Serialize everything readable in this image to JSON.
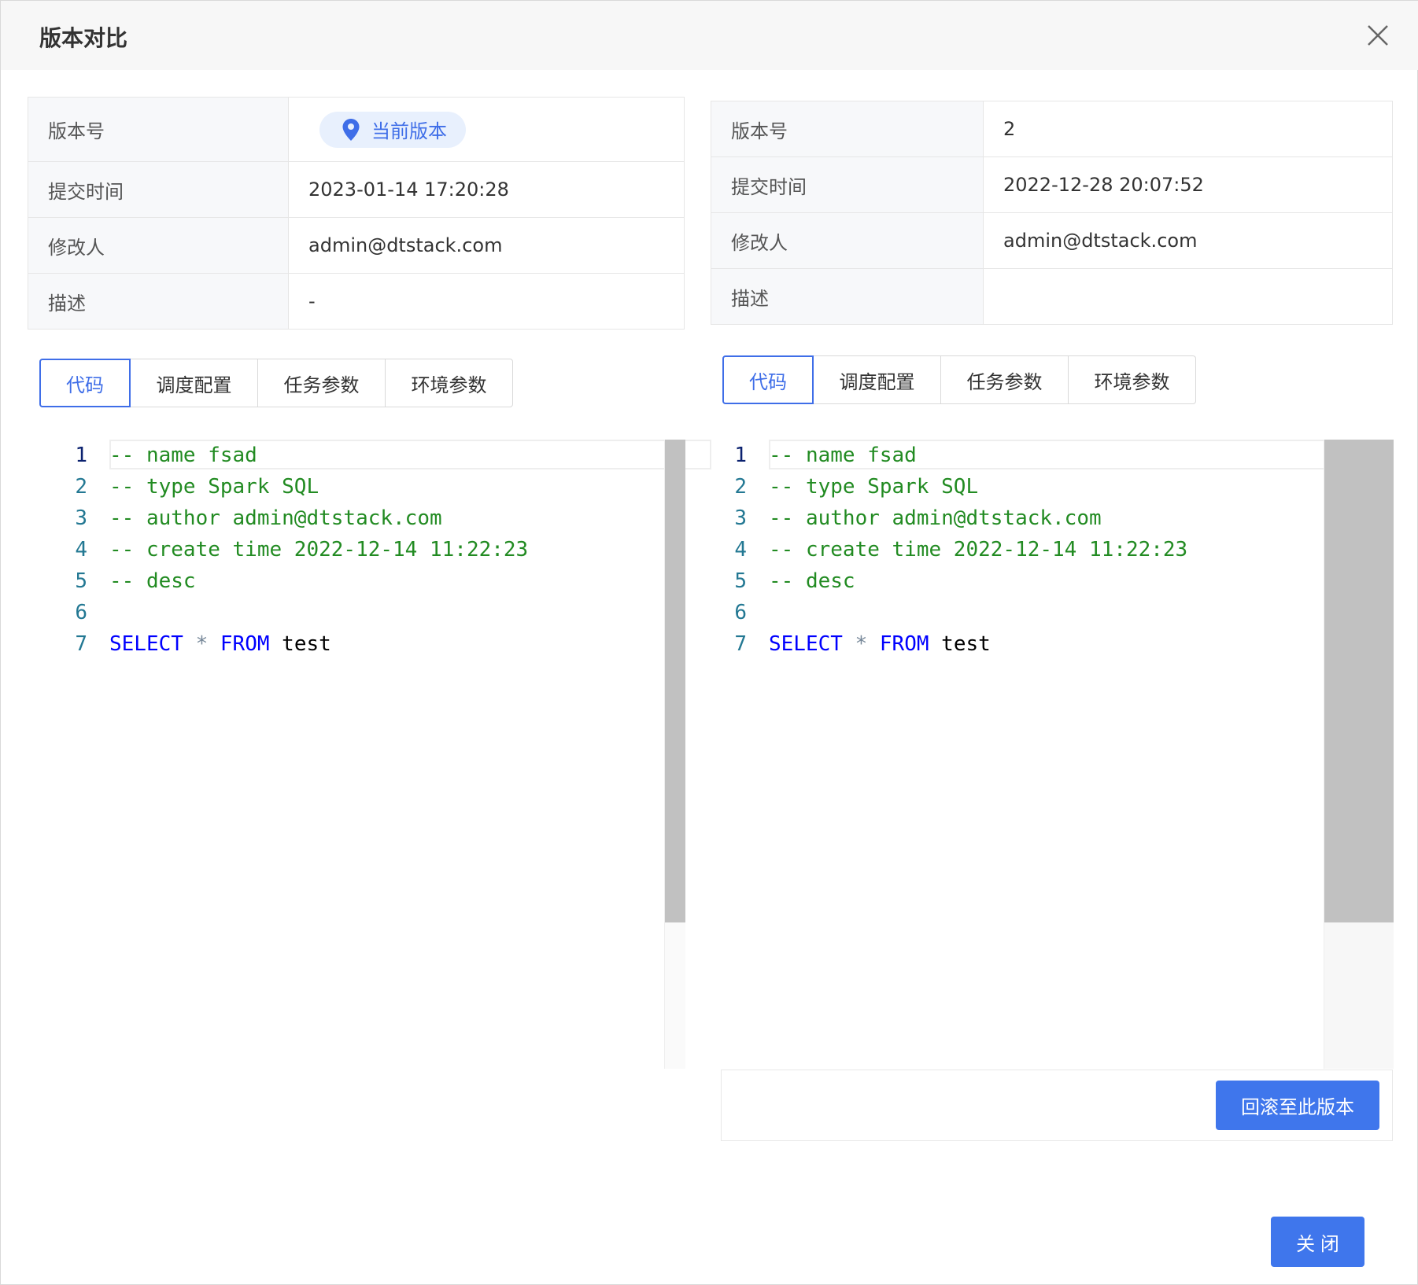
{
  "dialog": {
    "title": "版本对比",
    "close_label": "关 闭",
    "rollback_label": "回滚至此版本"
  },
  "left": {
    "rows": [
      {
        "key": "版本号",
        "value": "当前版本"
      },
      {
        "key": "提交时间",
        "value": "2023-01-14 17:20:28"
      },
      {
        "key": "修改人",
        "value": "admin@dtstack.com"
      },
      {
        "key": "描述",
        "value": "-"
      }
    ],
    "tabs": [
      "代码",
      "调度配置",
      "任务参数",
      "环境参数"
    ],
    "active_tab": "代码"
  },
  "right": {
    "rows": [
      {
        "key": "版本号",
        "value": "2"
      },
      {
        "key": "提交时间",
        "value": "2022-12-28 20:07:52"
      },
      {
        "key": "修改人",
        "value": "admin@dtstack.com"
      },
      {
        "key": "描述",
        "value": ""
      }
    ],
    "tabs": [
      "代码",
      "调度配置",
      "任务参数",
      "环境参数"
    ],
    "active_tab": "代码"
  },
  "code": {
    "line_numbers": [
      "1",
      "2",
      "3",
      "4",
      "5",
      "6",
      "7"
    ],
    "comments": [
      "-- name fsad",
      "-- type Spark SQL",
      "-- author admin@dtstack.com",
      "-- create time 2022-12-14 11:22:23",
      "-- desc"
    ],
    "kw_select": "SELECT",
    "op_star": "*",
    "kw_from": "FROM",
    "ident": "test"
  },
  "colors": {
    "primary": "#3f76ec",
    "accent_text": "#3f6ee8",
    "comment": "#228b22",
    "keyword": "#0000ff",
    "line_number": "#237893"
  }
}
